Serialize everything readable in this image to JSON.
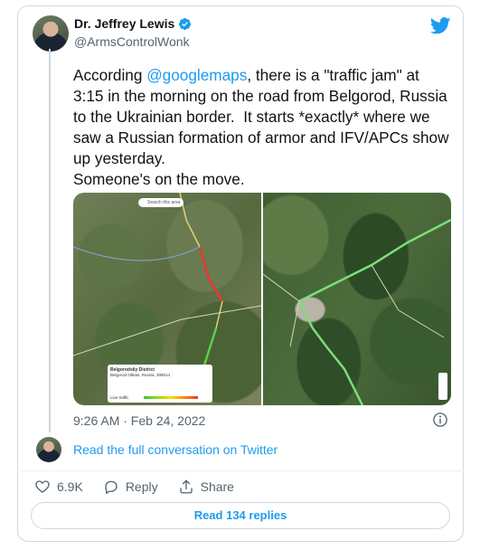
{
  "author": {
    "display_name": "Dr. Jeffrey Lewis",
    "handle": "@ArmsControlWonk"
  },
  "tweet": {
    "text_before_mention": "According ",
    "mention": "@googlemaps",
    "text_after_mention": ", there is a \"traffic jam\" at 3:15 in the morning on the road from Belgorod, Russia to the Ukrainian border.  It starts *exactly* where we saw a Russian formation of armor and IFV/APCs show up yesterday.\nSomeone's on the move.",
    "timestamp": "9:26 AM · Feb 24, 2022"
  },
  "media": {
    "left_map": {
      "search_placeholder": "Search this area",
      "info_title": "Belgorodsky District",
      "info_subtitle": "Belgorod Oblast, Russia, 308014",
      "info_traffic_label": "Live traffic"
    }
  },
  "footer": {
    "read_full_label": "Read the full conversation on Twitter",
    "likes_count": "6.9K",
    "reply_label": "Reply",
    "share_label": "Share",
    "read_replies_label": "Read 134 replies"
  },
  "colors": {
    "accent": "#1d9bf0",
    "secondary_text": "#536471",
    "border": "#cfd9de"
  },
  "icons": [
    "verified-badge-icon",
    "twitter-bird-icon",
    "info-icon",
    "heart-icon",
    "reply-bubble-icon",
    "share-icon"
  ]
}
